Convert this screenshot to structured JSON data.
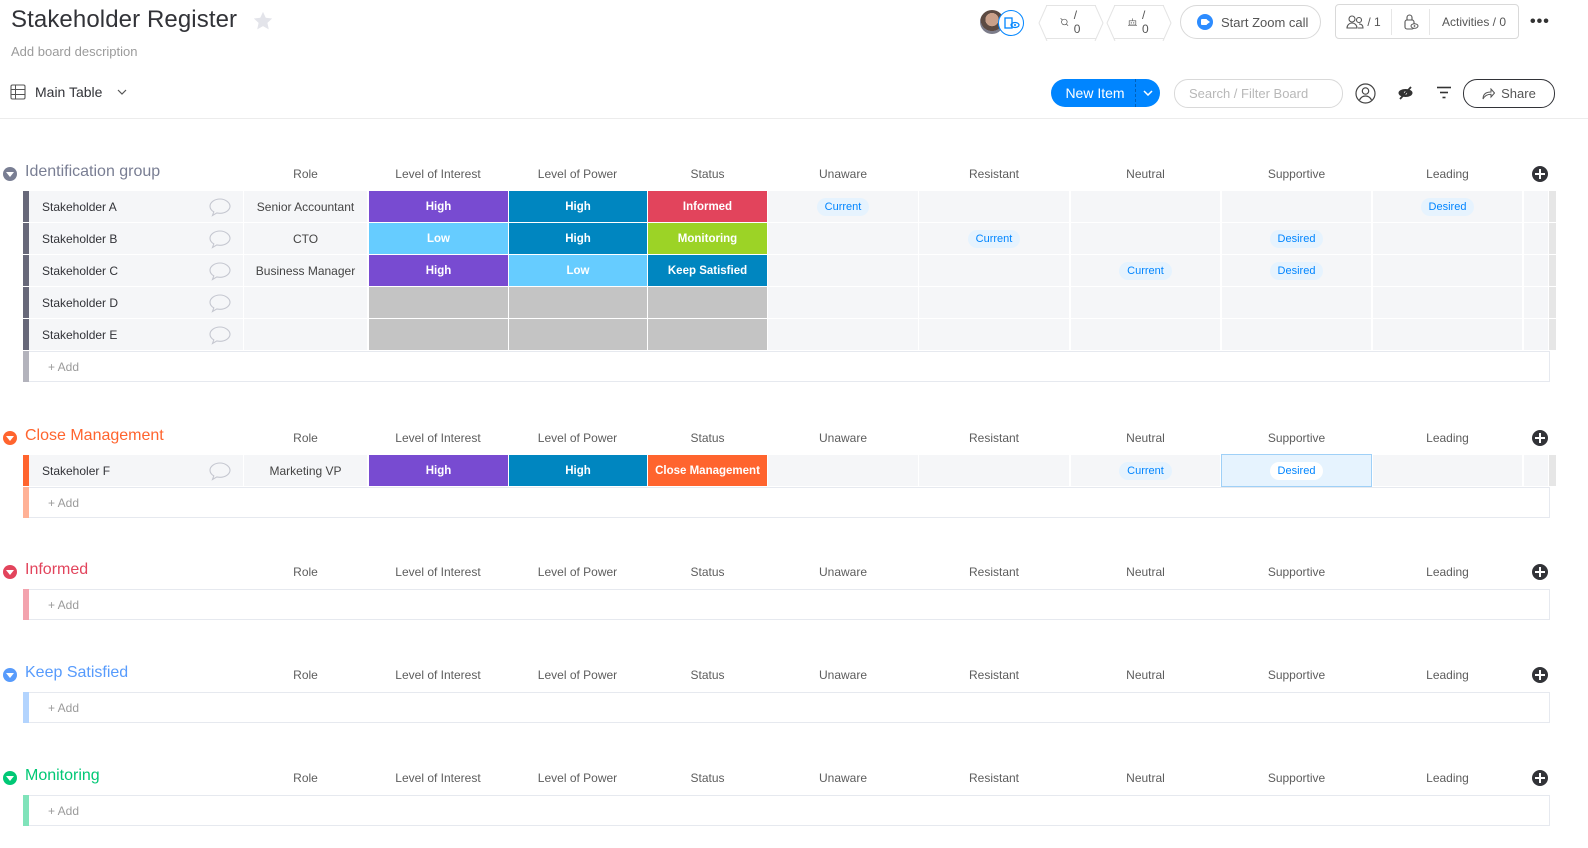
{
  "header": {
    "title": "Stakeholder Register",
    "description": "Add board description",
    "updates_count": "/ 0",
    "integrations_count": "/ 0",
    "zoom_label": "Start Zoom call",
    "members_count": "/ 1",
    "activities_label": "Activities / 0"
  },
  "toolbar": {
    "view_label": "Main Table",
    "new_item_label": "New Item",
    "search_placeholder": "Search / Filter Board",
    "share_label": "Share"
  },
  "columns": [
    "Role",
    "Level of Interest",
    "Level of Power",
    "Status",
    "Unaware",
    "Resistant",
    "Neutral",
    "Supportive",
    "Leading"
  ],
  "colors": {
    "high_interest": "#784bd1",
    "low": "#66ccff",
    "high_power": "#0086c0",
    "informed": "#e2445c",
    "monitoring": "#9cd326",
    "keep_satisfied": "#0086c0",
    "close_management": "#ff642e",
    "empty": "#c4c4c4"
  },
  "groups": [
    {
      "title": "Identification group",
      "color": "#797e93",
      "strip": "#676879",
      "add_label": "+ Add",
      "rows": [
        {
          "name": "Stakeholder A",
          "role": "Senior Accountant",
          "interest": "High",
          "power": "High",
          "status": "Informed",
          "engagement": {
            "Unaware": "Current",
            "Leading": "Desired"
          }
        },
        {
          "name": "Stakeholder B",
          "role": "CTO",
          "interest": "Low",
          "power": "High",
          "status": "Monitoring",
          "engagement": {
            "Resistant": "Current",
            "Supportive": "Desired"
          }
        },
        {
          "name": "Stakeholder C",
          "role": "Business Manager",
          "interest": "High",
          "power": "Low",
          "status": "Keep Satisfied",
          "engagement": {
            "Neutral": "Current",
            "Supportive": "Desired"
          }
        },
        {
          "name": "Stakeholder D",
          "role": "",
          "interest": "",
          "power": "",
          "status": "",
          "engagement": {}
        },
        {
          "name": "Stakeholder E",
          "role": "",
          "interest": "",
          "power": "",
          "status": "",
          "engagement": {}
        }
      ]
    },
    {
      "title": "Close Management",
      "color": "#ff642e",
      "strip": "#ff642e",
      "add_label": "+ Add",
      "rows": [
        {
          "name": "Stakeholer F",
          "role": "Marketing VP",
          "interest": "High",
          "power": "High",
          "status": "Close Management",
          "engagement": {
            "Neutral": "Current",
            "Supportive": "Desired"
          },
          "selected": "Supportive"
        }
      ]
    },
    {
      "title": "Informed",
      "color": "#e2445c",
      "strip": "#f3a3ae",
      "add_label": "+ Add",
      "rows": []
    },
    {
      "title": "Keep Satisfied",
      "color": "#579bfc",
      "strip": "#b3d4fe",
      "add_label": "+ Add",
      "rows": []
    },
    {
      "title": "Monitoring",
      "color": "#00c875",
      "strip": "#80e3ba",
      "add_label": "+ Add",
      "rows": []
    }
  ]
}
